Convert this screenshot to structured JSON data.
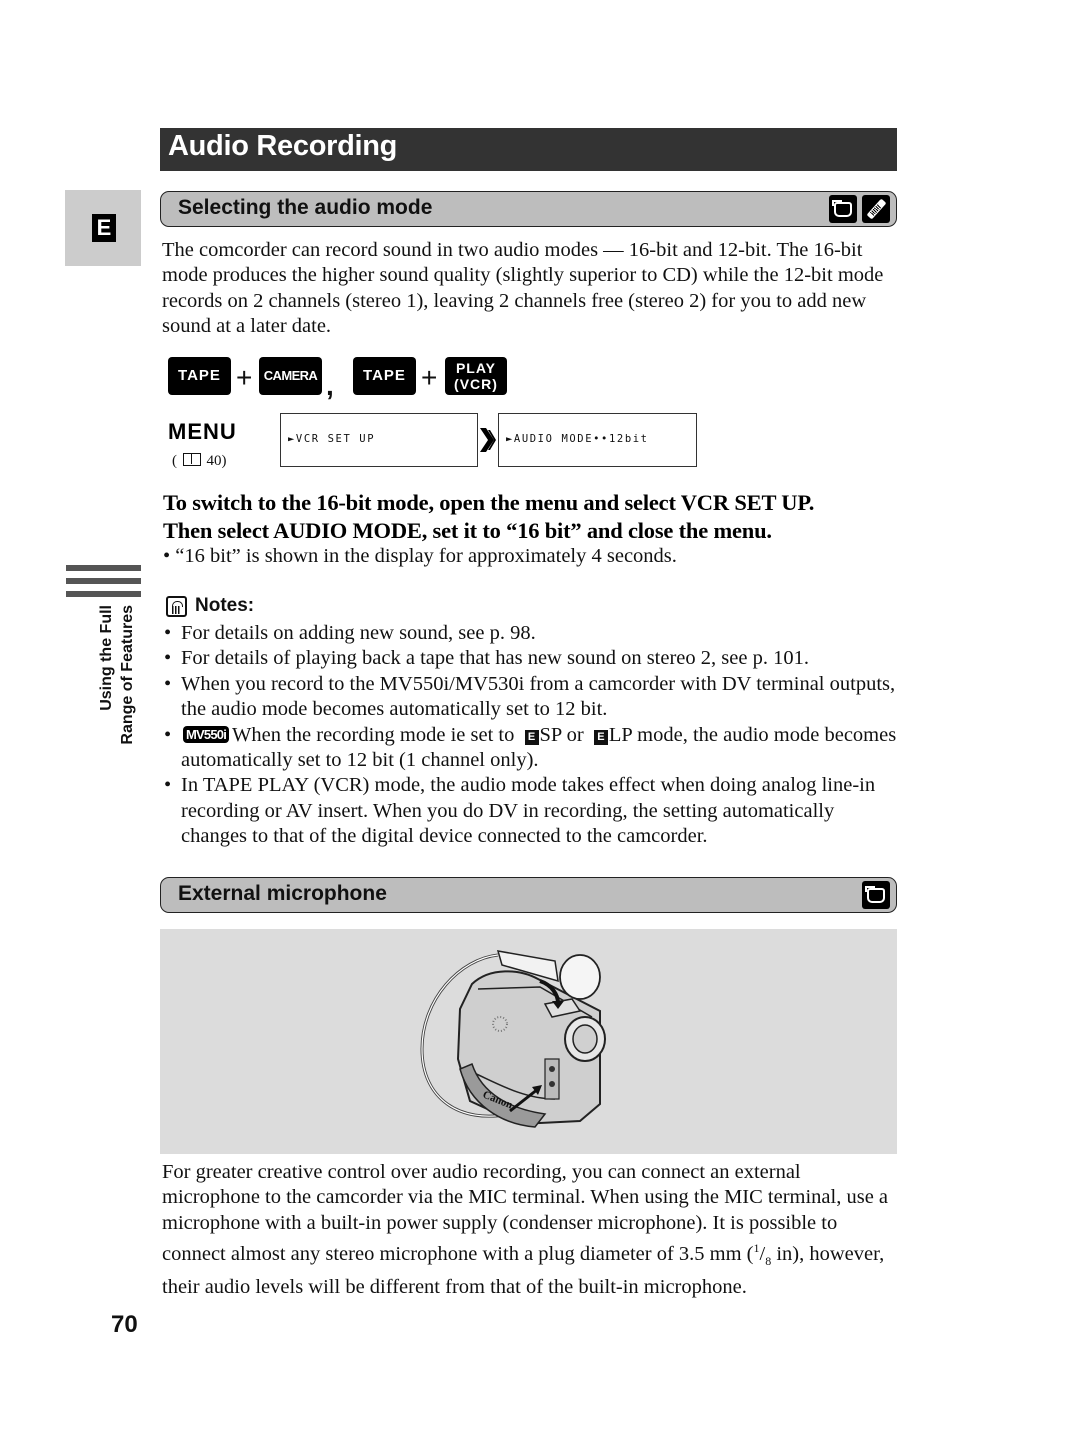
{
  "page": {
    "title": "Audio Recording",
    "language_tab": "E",
    "page_number": "70",
    "side_label": [
      "Using the Full",
      "Range of Features"
    ]
  },
  "section_audio_mode": {
    "heading": "Selecting the audio mode",
    "icons": [
      "camcorder-mode-icon",
      "wireless-remote-icon"
    ],
    "intro": "The comcorder can record sound in two audio modes — 16-bit and 12-bit. The 16-bit mode produces the higher sound quality (slightly superior to CD) while the 12-bit mode records on 2 channels (stereo 1), leaving 2 channels free (stereo 2) for you to add new sound at a later date.",
    "mode_buttons": {
      "tape_1": "TAPE",
      "plus_1": "+",
      "camera": "CAMERA",
      "separator": ",",
      "tape_2": "TAPE",
      "plus_2": "+",
      "play_line1": "PLAY",
      "play_line2": "(VCR)"
    },
    "menu": {
      "label": "MENU",
      "ref_open": "(",
      "ref_page": "40)",
      "screen_1": "►VCR SET UP",
      "screen_2": "►AUDIO MODE••12bit"
    },
    "instruction_line1": "To switch to the 16-bit mode, open the menu and select VCR SET UP.",
    "instruction_line2": "Then select AUDIO MODE, set it to “16 bit” and close the menu.",
    "bullet": "•  “16 bit” is shown in the display for approximately 4 seconds."
  },
  "notes": {
    "title": "Notes:",
    "items": [
      "For details on adding new sound, see p. 98.",
      "For details of playing back a tape that has new sound on stereo 2, see p. 101.",
      "When you record to the MV550i/MV530i from a camcorder with DV terminal outputs, the audio mode becomes automatically set to 12 bit."
    ],
    "item4": {
      "badge": "MV550i",
      "text_a": "When the recording mode ie set to ",
      "mark_1": "E",
      "text_b": "SP or ",
      "mark_2": "E",
      "text_c": "LP mode, the audio mode becomes automatically set to 12 bit (1 channel only)."
    },
    "item5": "In TAPE PLAY (VCR) mode, the audio mode takes effect when doing analog line-in recording or AV insert. When you do DV in recording, the setting automatically changes to that of the digital device connected to the camcorder."
  },
  "section_external_mic": {
    "heading": "External microphone",
    "icons": [
      "camcorder-mode-icon"
    ],
    "illustration": "camcorder-with-external-microphone",
    "brand_text": "Canon",
    "para_a": "For greater creative control over audio recording, you can connect an external microphone to the camcorder via the MIC terminal. When using the MIC terminal, use a microphone with a built-in power supply (condenser microphone). It is possible to connect almost any stereo microphone with a plug diameter of 3.5 mm (",
    "frac_num": "1",
    "frac_sep": "/",
    "frac_den": "8",
    "para_b": " in), however, their audio levels will be different from that of the built-in microphone."
  }
}
